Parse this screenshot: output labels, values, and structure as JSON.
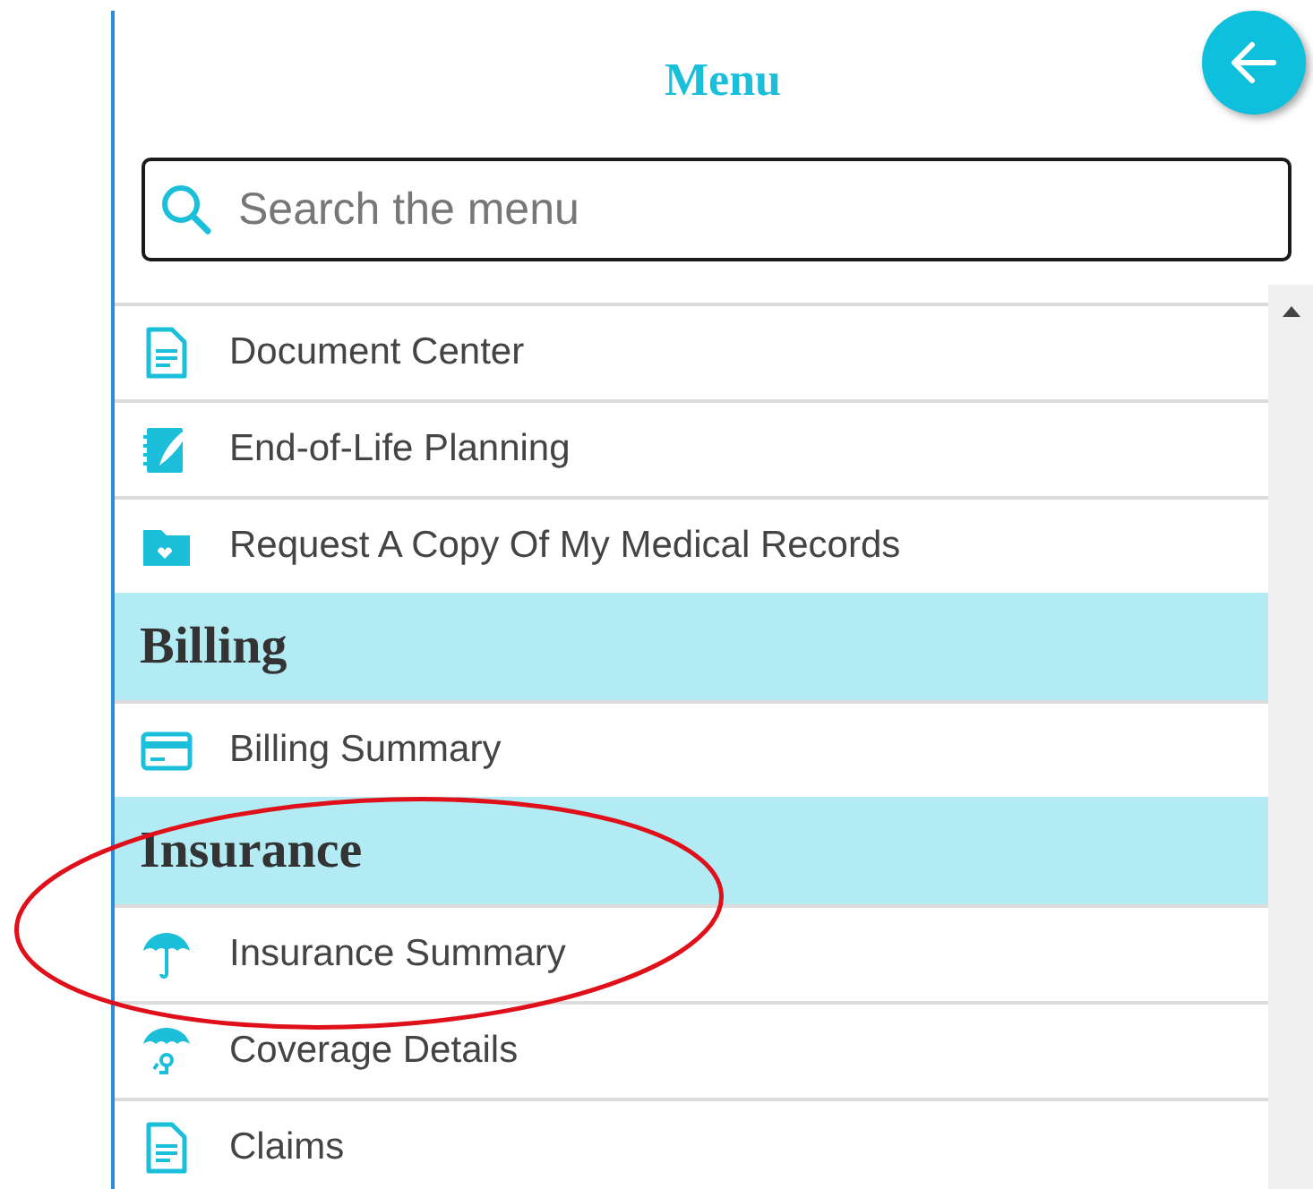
{
  "menu": {
    "title": "Menu"
  },
  "search": {
    "placeholder": "Search the menu"
  },
  "items": [
    {
      "kind": "link",
      "label": "Document Center"
    },
    {
      "kind": "link",
      "label": "End-of-Life Planning"
    },
    {
      "kind": "link",
      "label": "Request A Copy Of My Medical Records"
    },
    {
      "kind": "header",
      "label": "Billing"
    },
    {
      "kind": "link",
      "label": "Billing Summary"
    },
    {
      "kind": "header",
      "label": "Insurance"
    },
    {
      "kind": "link",
      "label": "Insurance Summary"
    },
    {
      "kind": "link",
      "label": "Coverage Details"
    },
    {
      "kind": "link",
      "label": "Claims"
    }
  ],
  "annotation": {
    "kind": "ellipse"
  }
}
